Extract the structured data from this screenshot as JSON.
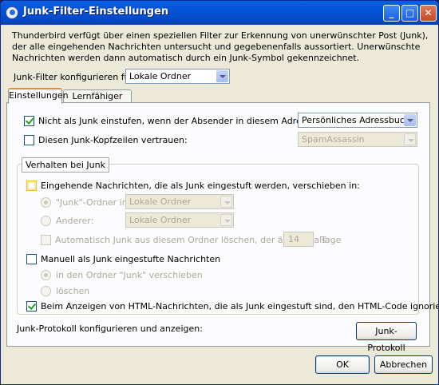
{
  "window": {
    "title": "Junk-Filter-Einstellungen",
    "controls": [
      "_",
      "□",
      "✕"
    ]
  },
  "description": "Thunderbird verfügt über einen speziellen Filter zur Erkennung von unerwünschter Post (Junk), der alle eingehenden Nachrichten untersucht und gegebenenfalls aussortiert. Unerwünschte Nachrichten werden dann automatisch durch ein Junk-Symbol gekennzeichnet.",
  "configure": {
    "label": "Junk-Filter konfigurieren für:",
    "value": "Lokale Ordner"
  },
  "tabs": [
    "Einstellungen",
    "Lernfähiger Filter"
  ],
  "settings": {
    "addressbook": {
      "label": "Nicht als Junk einstufen, wenn der Absender in diesem Adressbuch ist:",
      "value": "Persönliches Adressbuch",
      "checked": true
    },
    "headers": {
      "label": "Diesen Junk-Kopfzeilen vertrauen:",
      "value": "SpamAssassin",
      "checked": false
    }
  },
  "group": {
    "legend": "Verhalten bei Junk",
    "move": {
      "label": "Eingehende Nachrichten, die als Junk eingestuft werden, verschieben in:",
      "checked": false
    },
    "junk_folder": {
      "label": "\"Junk\"-Ordner in:",
      "value": "Lokale Ordner"
    },
    "other": {
      "label": "Anderer:",
      "value": "Lokale Ordner"
    },
    "auto_delete": {
      "label": "Automatisch Junk aus diesem Ordner löschen, der älter ist als",
      "days": "14",
      "unit": "Tage"
    },
    "manual": {
      "label": "Manuell als Junk eingestufte Nachrichten",
      "checked": false
    },
    "manual_move": {
      "label": "in den Ordner \"Junk\" verschieben"
    },
    "manual_delete": {
      "label": "löschen"
    },
    "html": {
      "label": "Beim Anzeigen von HTML-Nachrichten, die als Junk eingestuft sind, den HTML-Code ignorieren",
      "checked": true
    }
  },
  "log": {
    "label": "Junk-Protokoll konfigurieren und anzeigen:",
    "button": "Junk-Protokoll"
  },
  "buttons": {
    "ok": "OK",
    "cancel": "Abbrechen"
  }
}
